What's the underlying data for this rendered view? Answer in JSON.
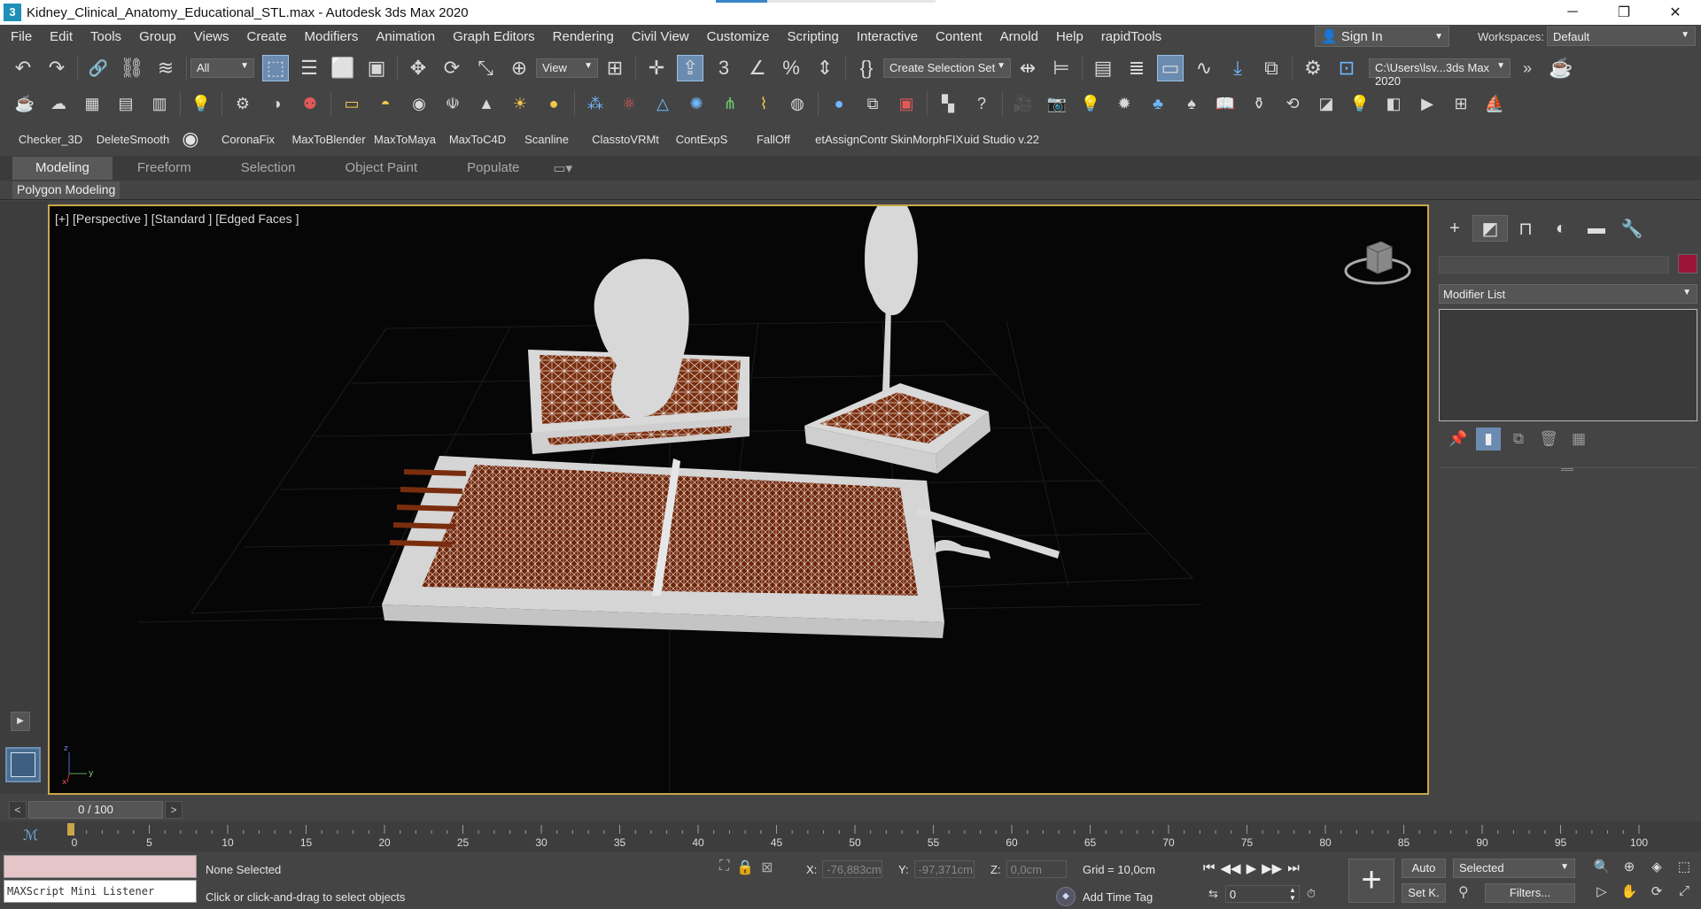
{
  "window": {
    "title": "Kidney_Clinical_Anatomy_Educational_STL.max - Autodesk 3ds Max 2020",
    "app_icon_glyph": "3",
    "minimize_glyph": "─",
    "restore_glyph": "❐",
    "close_glyph": "✕"
  },
  "menu": [
    "File",
    "Edit",
    "Tools",
    "Group",
    "Views",
    "Create",
    "Modifiers",
    "Animation",
    "Graph Editors",
    "Rendering",
    "Civil View",
    "Customize",
    "Scripting",
    "Interactive",
    "Content",
    "Arnold",
    "Help",
    "rapidTools"
  ],
  "account": {
    "sign_in": "Sign In",
    "workspaces_label": "Workspaces:",
    "workspace": "Default"
  },
  "main_toolbar": {
    "selection_filter": "All",
    "ref_coord": "View",
    "selection_set": "Create Selection Set",
    "project_path": "C:\\Users\\lsv...3ds Max 2020"
  },
  "shelf": [
    "Checker_3D",
    "DeleteSmooth",
    "CoronaFix",
    "MaxToBlender",
    "MaxToMaya",
    "MaxToC4D",
    "Scanline",
    "ClasstoVRMt",
    "ContExpS",
    "FallOff",
    "etAssignContr",
    "SkinMorphFIX",
    "uid Studio v.22"
  ],
  "ribbon": {
    "tabs": [
      "Modeling",
      "Freeform",
      "Selection",
      "Object Paint",
      "Populate"
    ],
    "active_tab": "Modeling",
    "panel": "Polygon Modeling"
  },
  "viewport": {
    "label_parts": [
      "[+]",
      "[Perspective ]",
      "[Standard ]",
      "[Edged Faces ]"
    ],
    "axis_z": "z",
    "axis_x": "x",
    "axis_y": "y"
  },
  "command_panel": {
    "modifier_list": "Modifier List",
    "object_color": "#9a1538"
  },
  "time": {
    "slider": "0 / 100",
    "prev": "<",
    "next": ">",
    "ticks": [
      "0",
      "5",
      "10",
      "15",
      "20",
      "25",
      "30",
      "35",
      "40",
      "45",
      "50",
      "55",
      "60",
      "65",
      "70",
      "75",
      "80",
      "85",
      "90",
      "95",
      "100"
    ]
  },
  "status": {
    "maxscript_label": "MAXScript Mini Listener",
    "selection": "None Selected",
    "prompt": "Click or click-and-drag to select objects",
    "x_label": "X:",
    "x_value": "-76,883cm",
    "y_label": "Y:",
    "y_value": "-97,371cm",
    "z_label": "Z:",
    "z_value": "0,0cm",
    "grid": "Grid = 10,0cm",
    "add_time_tag": "Add Time Tag",
    "frame": "0",
    "auto": "Auto",
    "set_key": "Set K.",
    "selected": "Selected",
    "filters": "Filters..."
  }
}
